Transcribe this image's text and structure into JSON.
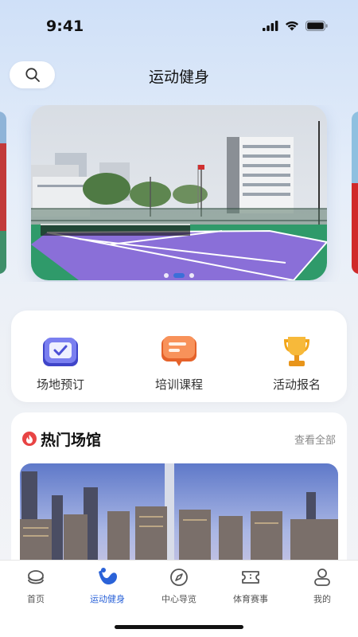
{
  "status_bar": {
    "time": "9:41"
  },
  "header": {
    "title": "运动健身"
  },
  "banner": {
    "slides": 3,
    "active_index": 1
  },
  "quick_actions": [
    {
      "label": "场地预订",
      "icon": "calendar-check-icon",
      "color": "#5a5fe0"
    },
    {
      "label": "培训课程",
      "icon": "chat-bubble-icon",
      "color": "#f07a3a"
    },
    {
      "label": "活动报名",
      "icon": "trophy-icon",
      "color": "#f2a51a"
    }
  ],
  "hot_venues": {
    "title": "热门场馆",
    "view_all": "查看全部"
  },
  "tabbar": {
    "active": "运动健身",
    "items": [
      {
        "label": "首页",
        "icon": "home-icon"
      },
      {
        "label": "运动健身",
        "icon": "fitness-icon"
      },
      {
        "label": "中心导览",
        "icon": "compass-icon"
      },
      {
        "label": "体育赛事",
        "icon": "ticket-icon"
      },
      {
        "label": "我的",
        "icon": "profile-icon"
      }
    ]
  },
  "colors": {
    "accent": "#2a62d8",
    "court": "#8a6fd8",
    "court_border": "#2f9a6a"
  }
}
